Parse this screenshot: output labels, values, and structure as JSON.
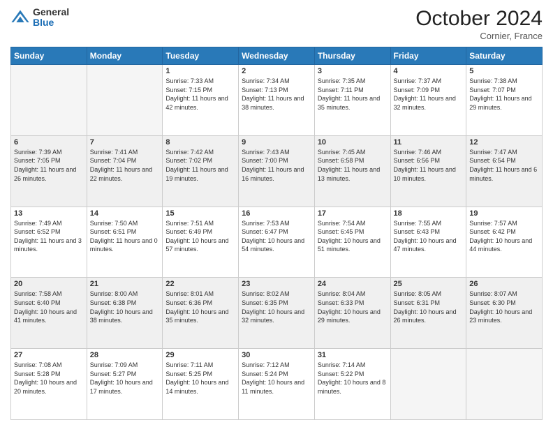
{
  "header": {
    "logo": {
      "general": "General",
      "blue": "Blue"
    },
    "month": "October 2024",
    "location": "Cornier, France"
  },
  "days": [
    "Sunday",
    "Monday",
    "Tuesday",
    "Wednesday",
    "Thursday",
    "Friday",
    "Saturday"
  ],
  "weeks": [
    [
      {
        "day": "",
        "empty": true
      },
      {
        "day": "",
        "empty": true
      },
      {
        "day": "1",
        "sunrise": "Sunrise: 7:33 AM",
        "sunset": "Sunset: 7:15 PM",
        "daylight": "Daylight: 11 hours and 42 minutes."
      },
      {
        "day": "2",
        "sunrise": "Sunrise: 7:34 AM",
        "sunset": "Sunset: 7:13 PM",
        "daylight": "Daylight: 11 hours and 38 minutes."
      },
      {
        "day": "3",
        "sunrise": "Sunrise: 7:35 AM",
        "sunset": "Sunset: 7:11 PM",
        "daylight": "Daylight: 11 hours and 35 minutes."
      },
      {
        "day": "4",
        "sunrise": "Sunrise: 7:37 AM",
        "sunset": "Sunset: 7:09 PM",
        "daylight": "Daylight: 11 hours and 32 minutes."
      },
      {
        "day": "5",
        "sunrise": "Sunrise: 7:38 AM",
        "sunset": "Sunset: 7:07 PM",
        "daylight": "Daylight: 11 hours and 29 minutes."
      }
    ],
    [
      {
        "day": "6",
        "sunrise": "Sunrise: 7:39 AM",
        "sunset": "Sunset: 7:05 PM",
        "daylight": "Daylight: 11 hours and 26 minutes."
      },
      {
        "day": "7",
        "sunrise": "Sunrise: 7:41 AM",
        "sunset": "Sunset: 7:04 PM",
        "daylight": "Daylight: 11 hours and 22 minutes."
      },
      {
        "day": "8",
        "sunrise": "Sunrise: 7:42 AM",
        "sunset": "Sunset: 7:02 PM",
        "daylight": "Daylight: 11 hours and 19 minutes."
      },
      {
        "day": "9",
        "sunrise": "Sunrise: 7:43 AM",
        "sunset": "Sunset: 7:00 PM",
        "daylight": "Daylight: 11 hours and 16 minutes."
      },
      {
        "day": "10",
        "sunrise": "Sunrise: 7:45 AM",
        "sunset": "Sunset: 6:58 PM",
        "daylight": "Daylight: 11 hours and 13 minutes."
      },
      {
        "day": "11",
        "sunrise": "Sunrise: 7:46 AM",
        "sunset": "Sunset: 6:56 PM",
        "daylight": "Daylight: 11 hours and 10 minutes."
      },
      {
        "day": "12",
        "sunrise": "Sunrise: 7:47 AM",
        "sunset": "Sunset: 6:54 PM",
        "daylight": "Daylight: 11 hours and 6 minutes."
      }
    ],
    [
      {
        "day": "13",
        "sunrise": "Sunrise: 7:49 AM",
        "sunset": "Sunset: 6:52 PM",
        "daylight": "Daylight: 11 hours and 3 minutes."
      },
      {
        "day": "14",
        "sunrise": "Sunrise: 7:50 AM",
        "sunset": "Sunset: 6:51 PM",
        "daylight": "Daylight: 11 hours and 0 minutes."
      },
      {
        "day": "15",
        "sunrise": "Sunrise: 7:51 AM",
        "sunset": "Sunset: 6:49 PM",
        "daylight": "Daylight: 10 hours and 57 minutes."
      },
      {
        "day": "16",
        "sunrise": "Sunrise: 7:53 AM",
        "sunset": "Sunset: 6:47 PM",
        "daylight": "Daylight: 10 hours and 54 minutes."
      },
      {
        "day": "17",
        "sunrise": "Sunrise: 7:54 AM",
        "sunset": "Sunset: 6:45 PM",
        "daylight": "Daylight: 10 hours and 51 minutes."
      },
      {
        "day": "18",
        "sunrise": "Sunrise: 7:55 AM",
        "sunset": "Sunset: 6:43 PM",
        "daylight": "Daylight: 10 hours and 47 minutes."
      },
      {
        "day": "19",
        "sunrise": "Sunrise: 7:57 AM",
        "sunset": "Sunset: 6:42 PM",
        "daylight": "Daylight: 10 hours and 44 minutes."
      }
    ],
    [
      {
        "day": "20",
        "sunrise": "Sunrise: 7:58 AM",
        "sunset": "Sunset: 6:40 PM",
        "daylight": "Daylight: 10 hours and 41 minutes."
      },
      {
        "day": "21",
        "sunrise": "Sunrise: 8:00 AM",
        "sunset": "Sunset: 6:38 PM",
        "daylight": "Daylight: 10 hours and 38 minutes."
      },
      {
        "day": "22",
        "sunrise": "Sunrise: 8:01 AM",
        "sunset": "Sunset: 6:36 PM",
        "daylight": "Daylight: 10 hours and 35 minutes."
      },
      {
        "day": "23",
        "sunrise": "Sunrise: 8:02 AM",
        "sunset": "Sunset: 6:35 PM",
        "daylight": "Daylight: 10 hours and 32 minutes."
      },
      {
        "day": "24",
        "sunrise": "Sunrise: 8:04 AM",
        "sunset": "Sunset: 6:33 PM",
        "daylight": "Daylight: 10 hours and 29 minutes."
      },
      {
        "day": "25",
        "sunrise": "Sunrise: 8:05 AM",
        "sunset": "Sunset: 6:31 PM",
        "daylight": "Daylight: 10 hours and 26 minutes."
      },
      {
        "day": "26",
        "sunrise": "Sunrise: 8:07 AM",
        "sunset": "Sunset: 6:30 PM",
        "daylight": "Daylight: 10 hours and 23 minutes."
      }
    ],
    [
      {
        "day": "27",
        "sunrise": "Sunrise: 7:08 AM",
        "sunset": "Sunset: 5:28 PM",
        "daylight": "Daylight: 10 hours and 20 minutes."
      },
      {
        "day": "28",
        "sunrise": "Sunrise: 7:09 AM",
        "sunset": "Sunset: 5:27 PM",
        "daylight": "Daylight: 10 hours and 17 minutes."
      },
      {
        "day": "29",
        "sunrise": "Sunrise: 7:11 AM",
        "sunset": "Sunset: 5:25 PM",
        "daylight": "Daylight: 10 hours and 14 minutes."
      },
      {
        "day": "30",
        "sunrise": "Sunrise: 7:12 AM",
        "sunset": "Sunset: 5:24 PM",
        "daylight": "Daylight: 10 hours and 11 minutes."
      },
      {
        "day": "31",
        "sunrise": "Sunrise: 7:14 AM",
        "sunset": "Sunset: 5:22 PM",
        "daylight": "Daylight: 10 hours and 8 minutes."
      },
      {
        "day": "",
        "empty": true
      },
      {
        "day": "",
        "empty": true
      }
    ]
  ]
}
